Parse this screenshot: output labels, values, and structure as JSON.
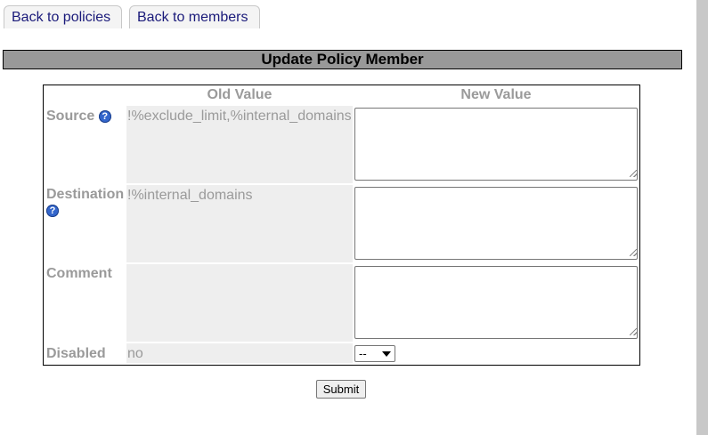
{
  "tabs": {
    "back_to_policies": "Back to policies",
    "back_to_members": "Back to members"
  },
  "title": "Update Policy Member",
  "headers": {
    "old_value": "Old Value",
    "new_value": "New Value"
  },
  "rows": {
    "source": {
      "label": "Source",
      "old": "!%exclude_limit,%internal_domains",
      "new": "",
      "help_icon": "question-icon"
    },
    "destination": {
      "label": "Destination",
      "old": "!%internal_domains",
      "new": "",
      "help_icon": "question-icon"
    },
    "comment": {
      "label": "Comment",
      "old": "",
      "new": ""
    },
    "disabled": {
      "label": "Disabled",
      "old": "no",
      "selected": "--"
    }
  },
  "help_glyph": "?",
  "submit_label": "Submit",
  "colors": {
    "title_bar_bg": "#999999",
    "old_value_bg": "#eeeeee",
    "label_text": "#9a9a9a",
    "tab_text": "#1a1a7a",
    "help_icon": "#3366cc"
  }
}
